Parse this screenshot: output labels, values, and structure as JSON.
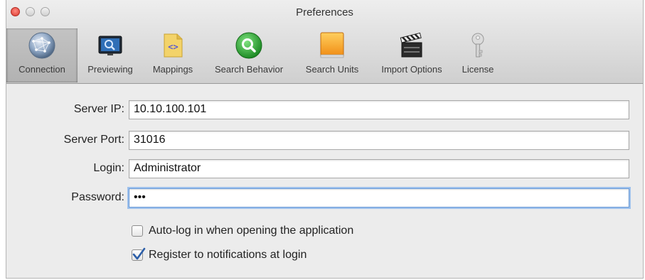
{
  "window": {
    "title": "Preferences"
  },
  "toolbar": {
    "items": [
      {
        "label": "Connection",
        "icon": "connection-globe-icon",
        "selected": true
      },
      {
        "label": "Previewing",
        "icon": "monitor-magnifier-icon"
      },
      {
        "label": "Mappings",
        "icon": "code-document-icon"
      },
      {
        "label": "Search Behavior",
        "icon": "green-search-icon"
      },
      {
        "label": "Search Units",
        "icon": "orange-drive-icon"
      },
      {
        "label": "Import Options",
        "icon": "clapperboard-icon"
      },
      {
        "label": "License",
        "icon": "key-icon"
      }
    ]
  },
  "form": {
    "server_ip": {
      "label": "Server IP:",
      "value": "10.10.100.101"
    },
    "server_port": {
      "label": "Server Port:",
      "value": "31016"
    },
    "login": {
      "label": "Login:",
      "value": "Administrator"
    },
    "password": {
      "label": "Password:",
      "value": "•••"
    }
  },
  "options": {
    "auto_login": {
      "label": "Auto-log in when opening the application",
      "checked": false
    },
    "register_notifications": {
      "label": "Register to notifications at login",
      "checked": true
    }
  },
  "colors": {
    "focus_ring": "#9ec1ec",
    "check_mark": "#2d5fa8",
    "close_button": "#d9382f"
  }
}
